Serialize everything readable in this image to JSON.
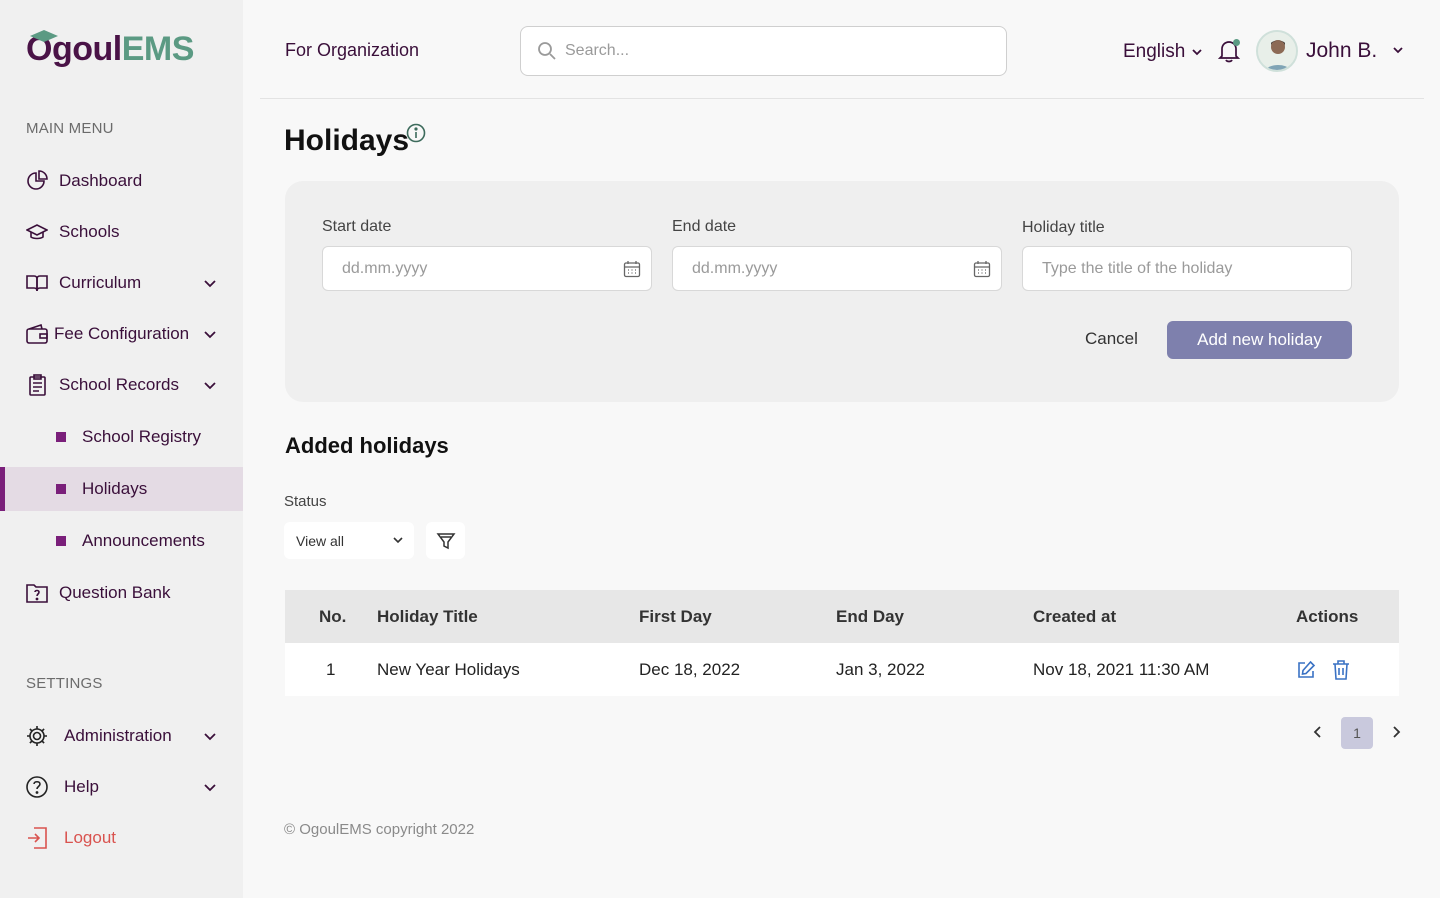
{
  "app": {
    "logo_part1": "Ogoul",
    "logo_part2": "EMS"
  },
  "sidebar": {
    "main_heading": "MAIN MENU",
    "items": [
      {
        "label": "Dashboard",
        "icon": "pie-chart-icon"
      },
      {
        "label": "Schools",
        "icon": "graduation-cap-icon"
      },
      {
        "label": "Curriculum",
        "icon": "book-open-icon"
      },
      {
        "label": "Fee Configuration",
        "icon": "wallet-icon"
      },
      {
        "label": "School Records",
        "icon": "clipboard-icon"
      },
      {
        "label": "School Registry"
      },
      {
        "label": "Holidays"
      },
      {
        "label": "Announcements"
      },
      {
        "label": "Question Bank",
        "icon": "folder-question-icon"
      }
    ],
    "settings_heading": "SETTINGS",
    "settings_items": [
      {
        "label": "Administration",
        "icon": "gear-icon"
      },
      {
        "label": "Help",
        "icon": "question-circle-icon"
      },
      {
        "label": "Logout",
        "icon": "logout-icon"
      }
    ]
  },
  "header": {
    "org_label": "For Organization",
    "search_placeholder": "Search...",
    "language": "English",
    "user_name": "John B."
  },
  "page": {
    "title": "Holidays"
  },
  "form": {
    "start_label": "Start date",
    "start_placeholder": "dd.mm.yyyy",
    "end_label": "End date",
    "end_placeholder": "dd.mm.yyyy",
    "title_label": "Holiday title",
    "title_placeholder": "Type the title of the holiday",
    "cancel_label": "Cancel",
    "add_label": "Add new holiday"
  },
  "list": {
    "section_title": "Added holidays",
    "status_label": "Status",
    "status_value": "View all"
  },
  "table": {
    "columns": [
      "No.",
      "Holiday Title",
      "First Day",
      "End Day",
      "Created at",
      "Actions"
    ],
    "rows": [
      {
        "no": "1",
        "title": "New Year Holidays",
        "first_day": "Dec 18, 2022",
        "end_day": "Jan 3, 2022",
        "created_at": "Nov 18, 2021 11:30 AM"
      }
    ]
  },
  "pagination": {
    "current_page": "1"
  },
  "footer": {
    "copyright": "© OgoulEMS copyright 2022"
  },
  "colors": {
    "brand_purple": "#4a1347",
    "brand_green": "#5b9a83",
    "accent": "#7a1f7a",
    "button": "#7e80ad",
    "logout": "#d9534f"
  }
}
